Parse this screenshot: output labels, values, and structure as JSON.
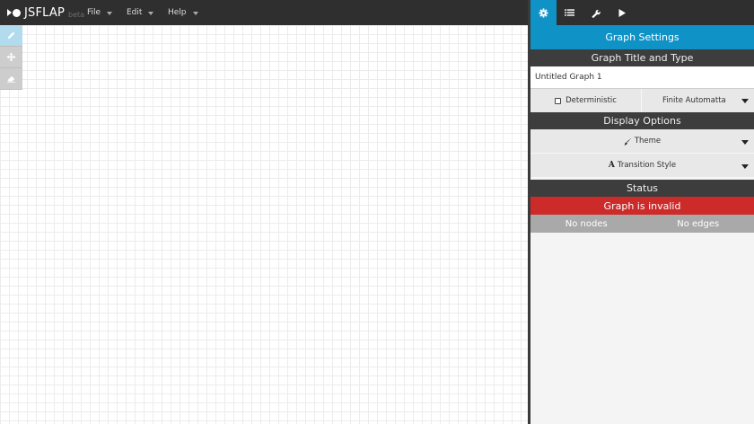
{
  "app": {
    "name": "JSFLAP",
    "badge": "beta"
  },
  "menus": [
    {
      "label": "File"
    },
    {
      "label": "Edit"
    },
    {
      "label": "Help"
    }
  ],
  "tools": [
    {
      "icon": "pencil-icon",
      "active": true
    },
    {
      "icon": "move-icon",
      "active": false
    },
    {
      "icon": "eraser-icon",
      "active": false
    }
  ],
  "panel_tabs": [
    {
      "icon": "gear-icon",
      "active": true
    },
    {
      "icon": "list-icon",
      "active": false
    },
    {
      "icon": "wrench-icon",
      "active": false
    },
    {
      "icon": "play-icon",
      "active": false
    }
  ],
  "settings": {
    "title": "Graph Settings",
    "title_type_header": "Graph Title and Type",
    "graph_title": "Untitled Graph 1",
    "deterministic_label": "Deterministic",
    "deterministic_checked": false,
    "type_value": "Finite Automatta",
    "display_header": "Display Options",
    "theme_label": "Theme",
    "transition_label": "Transition Style",
    "status_header": "Status",
    "status_message": "Graph is invalid",
    "nodes_label": "No nodes",
    "edges_label": "No edges"
  },
  "colors": {
    "accent": "#0f92c6",
    "error": "#cd2a2a",
    "topbar": "#2f2f2f"
  }
}
